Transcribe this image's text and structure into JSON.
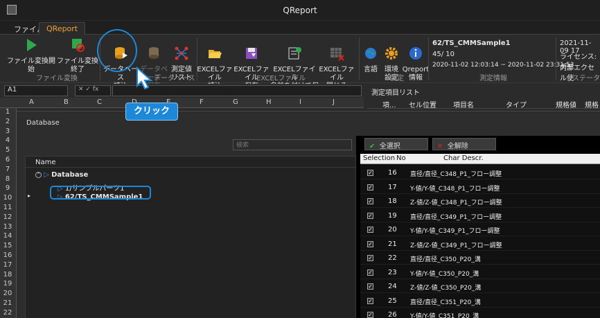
{
  "window": {
    "title": "QReport"
  },
  "tabs": [
    {
      "label": "ファイル"
    },
    {
      "label": "QReport"
    }
  ],
  "ribbon": {
    "file_convert": {
      "label": "ファイル変換",
      "buttons": [
        "ファイル変換開始",
        "ファイル変換終了"
      ]
    },
    "database": {
      "label": "データベース",
      "buttons": [
        "データベース\n読込",
        "データベース\n保存",
        "測定値\nリスト"
      ]
    },
    "excel": {
      "label": "EXCELファイル",
      "buttons": [
        "EXCELファイル\n読込",
        "EXCELファイル\n保存",
        "EXCELファイル\n名前を付けて保存",
        "EXCELファイル\n閉じる"
      ]
    },
    "settings": {
      "label": "設定",
      "buttons": [
        "言語",
        "環境\n設定",
        "Qreport\n情報"
      ]
    },
    "measure": {
      "label": "測定情報",
      "name": "62/TS_CMMSample1",
      "count": "45/ 10",
      "range": "2020-11-02 12:03:14 ~ 2020-11-02 23:31:53"
    },
    "status": {
      "label": "ステータス",
      "date": "2021-11-09 17",
      "license": "ライセンス:デモ",
      "mode": "内部エクセル使"
    }
  },
  "formula": {
    "cell": "A1",
    "fx": "fx"
  },
  "columns": [
    "A",
    "B",
    "C",
    "D",
    "E",
    "F",
    "G",
    "H",
    "I",
    "J"
  ],
  "rows": [
    "1",
    "2",
    "3",
    "4",
    "5",
    "6",
    "7",
    "8",
    "9",
    "10",
    "11",
    "12",
    "13",
    "14",
    "15",
    "16",
    "17",
    "18",
    "19",
    "20",
    "21",
    "22"
  ],
  "panel": {
    "title": "測定項目リスト",
    "cols": [
      "項...",
      "セル位置",
      "項目名",
      "タイプ",
      "規格値",
      "規格上"
    ]
  },
  "dialog": {
    "title": "Database",
    "search_placeholder": "検索",
    "tree_header": "Name",
    "tree": [
      "Database",
      "1/サンプルパーツ1",
      "62/TS_CMMSample1"
    ],
    "select_all": "全選択",
    "clear_all": "全解除",
    "grid_headers": [
      "Selection",
      "No",
      "Char Descr."
    ],
    "rows": [
      {
        "no": "16",
        "desc": "直径/直径_C348_P1_フロー調整"
      },
      {
        "no": "17",
        "desc": "Y-値/Y-値_C348_P1_フロー調整"
      },
      {
        "no": "18",
        "desc": "Z-値/Z-値_C348_P1_フロー調整"
      },
      {
        "no": "19",
        "desc": "直径/直径_C349_P1_フロー調整"
      },
      {
        "no": "20",
        "desc": "Y-値/Y-値_C349_P1_フロー調整"
      },
      {
        "no": "21",
        "desc": "Z-値/Z-値_C349_P1_フロー調整"
      },
      {
        "no": "22",
        "desc": "直径/直径_C350_P20_溝"
      },
      {
        "no": "23",
        "desc": "Y-値/Y-値_C350_P20_溝"
      },
      {
        "no": "24",
        "desc": "Z-値/Z-値_C350_P20_溝"
      },
      {
        "no": "25",
        "desc": "直径/直径_C351_P20_溝"
      },
      {
        "no": "26",
        "desc": "Y-値/Y-値_C351_P20_溝"
      }
    ]
  },
  "callout": "クリック",
  "colors": {
    "accent": "#1e88d8",
    "tab_active": "#f0a030"
  }
}
